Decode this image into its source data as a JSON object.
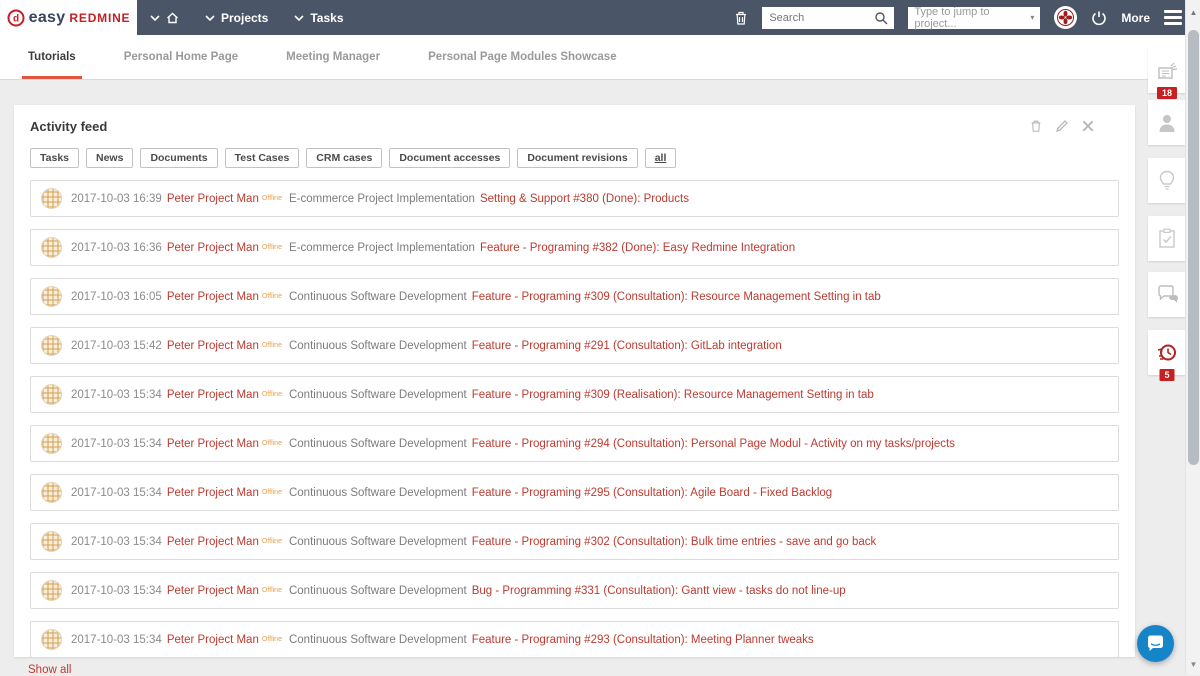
{
  "navbar": {
    "logo_easy": "easy",
    "logo_redmine": "REDMINE",
    "projects_label": "Projects",
    "tasks_label": "Tasks",
    "more_label": "More",
    "search_placeholder": "Search",
    "jump_placeholder": "Type to jump to project..."
  },
  "tabs": [
    {
      "label": "Tutorials",
      "active": true
    },
    {
      "label": "Personal Home Page",
      "active": false
    },
    {
      "label": "Meeting Manager",
      "active": false
    },
    {
      "label": "Personal Page Modules Showcase",
      "active": false
    }
  ],
  "activity_feed": {
    "title": "Activity feed",
    "filters": [
      "Tasks",
      "News",
      "Documents",
      "Test Cases",
      "CRM cases",
      "Document accesses",
      "Document revisions",
      "all"
    ],
    "rows": [
      {
        "datetime": "2017-10-03 16:39",
        "user": "Peter Project Man",
        "presence": "Offline",
        "project": "E-commerce Project Implementation",
        "task": "Setting & Support #380 (Done): Products"
      },
      {
        "datetime": "2017-10-03 16:36",
        "user": "Peter Project Man",
        "presence": "Offline",
        "project": "E-commerce Project Implementation",
        "task": "Feature - Programing #382 (Done): Easy Redmine Integration"
      },
      {
        "datetime": "2017-10-03 16:05",
        "user": "Peter Project Man",
        "presence": "Offline",
        "project": "Continuous Software Development",
        "task": "Feature - Programing #309 (Consultation): Resource Management Setting in tab"
      },
      {
        "datetime": "2017-10-03 15:42",
        "user": "Peter Project Man",
        "presence": "Offline",
        "project": "Continuous Software Development",
        "task": "Feature - Programing #291 (Consultation): GitLab integration"
      },
      {
        "datetime": "2017-10-03 15:34",
        "user": "Peter Project Man",
        "presence": "Offline",
        "project": "Continuous Software Development",
        "task": "Feature - Programing #309 (Realisation): Resource Management Setting in tab"
      },
      {
        "datetime": "2017-10-03 15:34",
        "user": "Peter Project Man",
        "presence": "Offline",
        "project": "Continuous Software Development",
        "task": "Feature - Programing #294 (Consultation): Personal Page Modul - Activity on my tasks/projects"
      },
      {
        "datetime": "2017-10-03 15:34",
        "user": "Peter Project Man",
        "presence": "Offline",
        "project": "Continuous Software Development",
        "task": "Feature - Programing #295 (Consultation): Agile Board - Fixed Backlog"
      },
      {
        "datetime": "2017-10-03 15:34",
        "user": "Peter Project Man",
        "presence": "Offline",
        "project": "Continuous Software Development",
        "task": "Feature - Programing #302 (Consultation): Bulk time entries - save and go back"
      },
      {
        "datetime": "2017-10-03 15:34",
        "user": "Peter Project Man",
        "presence": "Offline",
        "project": "Continuous Software Development",
        "task": "Bug - Programming #331 (Consultation): Gantt view - tasks do not line-up"
      },
      {
        "datetime": "2017-10-03 15:34",
        "user": "Peter Project Man",
        "presence": "Offline",
        "project": "Continuous Software Development",
        "task": "Feature - Programing #293 (Consultation): Meeting Planner tweaks"
      }
    ],
    "show_all_label": "Show all"
  },
  "sidebar": {
    "news_badge": "18",
    "history_badge": "5"
  },
  "colors": {
    "navbar_bg": "#4b5568",
    "brand_red": "#c41f25",
    "link_red": "#bd3a30",
    "tab_accent": "#e0563f",
    "badge_red": "#c62020",
    "chat_blue": "#1585c8"
  }
}
